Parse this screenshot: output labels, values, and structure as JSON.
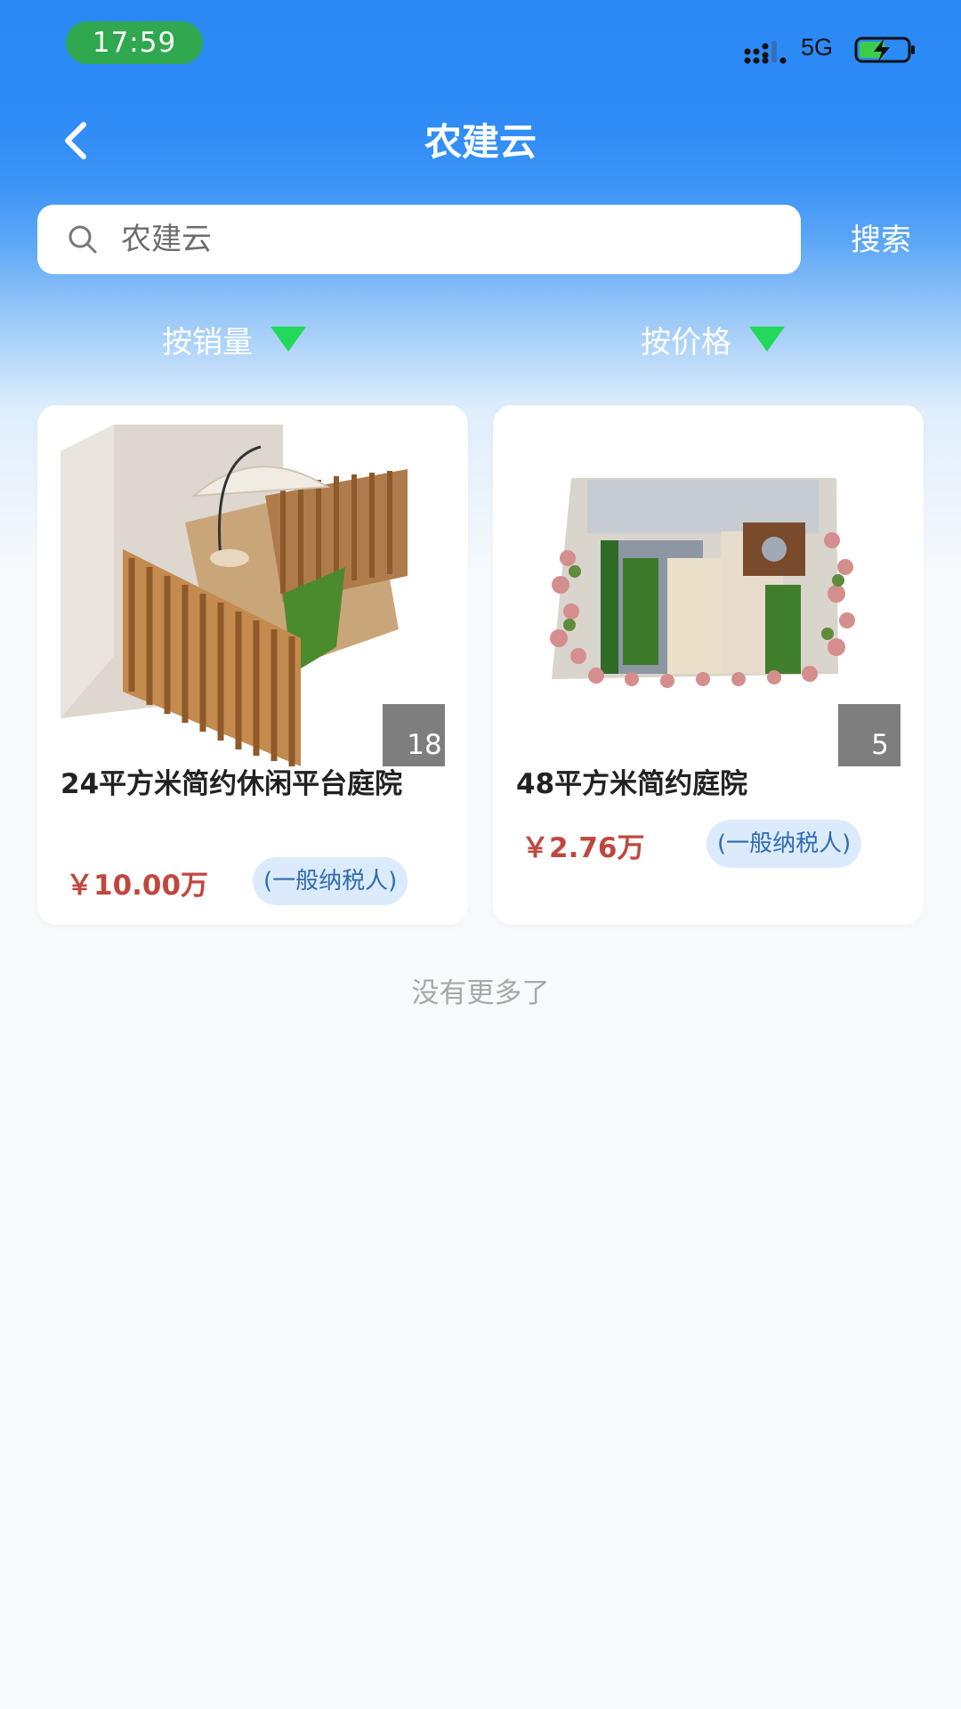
{
  "status_bar": {
    "time": "17:59",
    "network": "5G"
  },
  "header": {
    "title": "农建云",
    "back_icon": "chevron-left-icon"
  },
  "search": {
    "value": "",
    "placeholder": "农建云",
    "button_label": "搜索"
  },
  "sort": [
    {
      "label": "按销量",
      "icon": "triangle-down-icon"
    },
    {
      "label": "按价格",
      "icon": "triangle-down-icon"
    }
  ],
  "colors": {
    "header_blue": "#2a88f5",
    "price_red": "#c0473f",
    "sort_arrow_green": "#22d95a",
    "tag_bg": "#dcebfb",
    "tag_text": "#2f6bb1",
    "time_pill_green": "#2fa84f"
  },
  "products": [
    {
      "title": "24平方米简约休闲平台庭院",
      "count": "18",
      "price": "￥10.00万",
      "tag": "(一般纳税人)"
    },
    {
      "title": "48平方米简约庭院",
      "count": "5",
      "price": "￥2.76万",
      "tag": "(一般纳税人)"
    }
  ],
  "footer": {
    "no_more": "没有更多了"
  }
}
